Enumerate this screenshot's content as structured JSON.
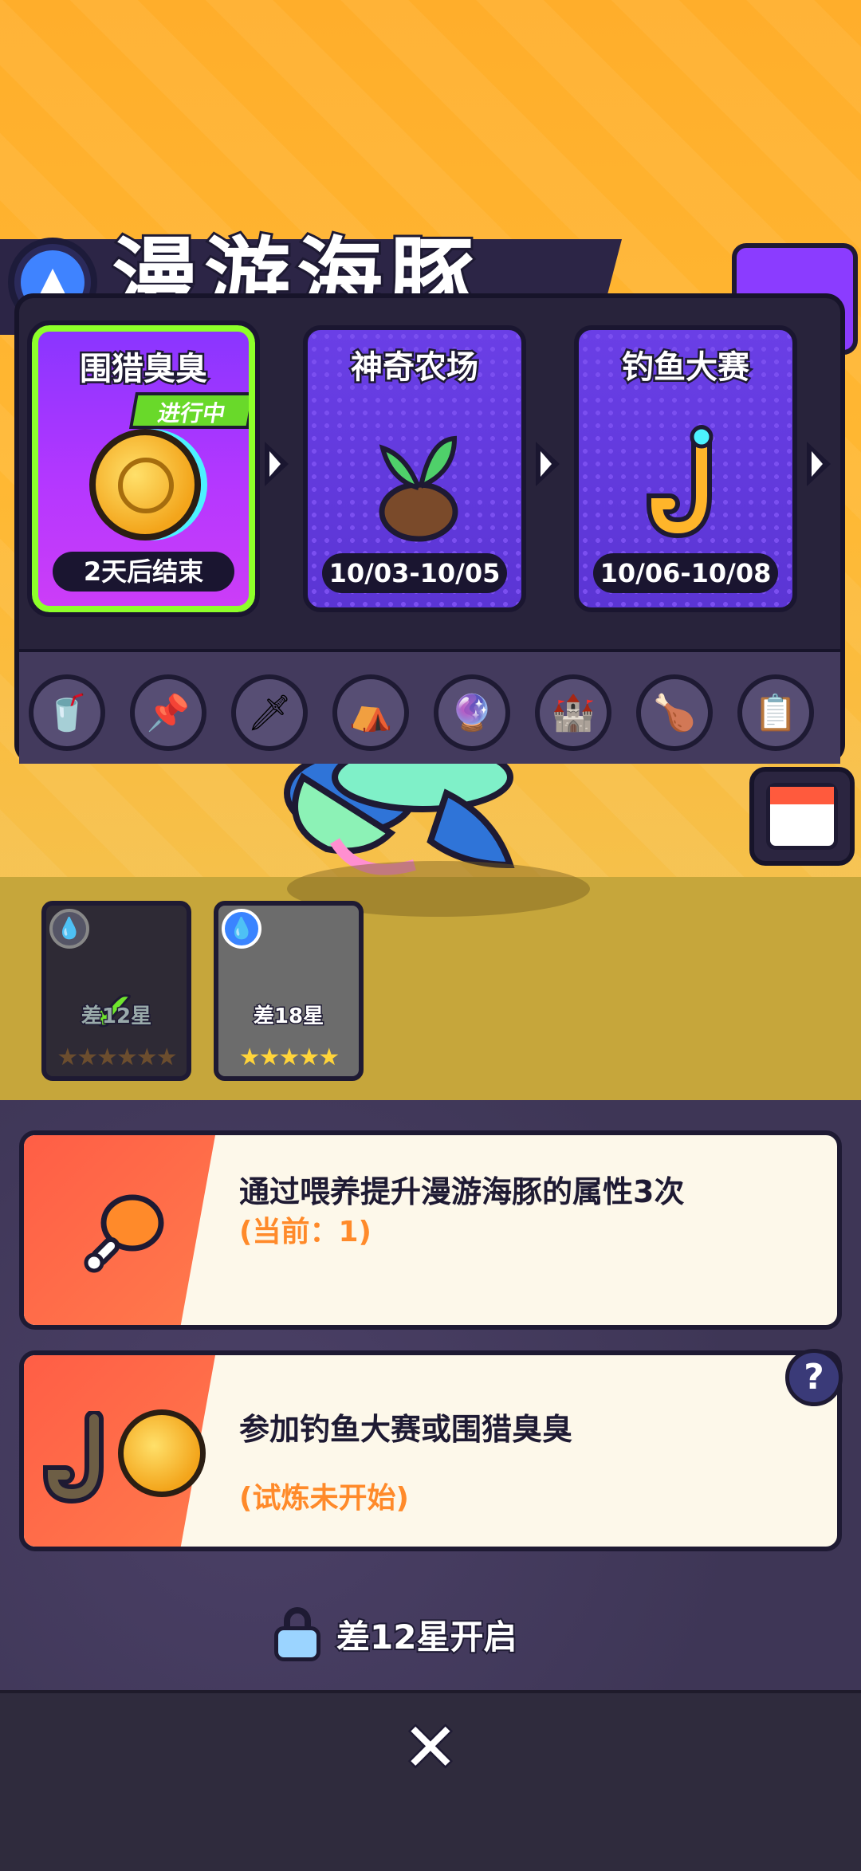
{
  "header": {
    "title": "漫游海豚"
  },
  "events": [
    {
      "title": "围猎臭臭",
      "status_badge": "进行中",
      "date": "2天后结束",
      "icon": "coin-icon",
      "active": true
    },
    {
      "title": "神奇农场",
      "date": "10/03-10/05",
      "icon": "sprout-icon",
      "active": false
    },
    {
      "title": "钓鱼大赛",
      "date": "10/06-10/08",
      "icon": "fishing-hook-icon",
      "active": false
    }
  ],
  "activity_icons": [
    "energy-drink-icon",
    "pin-icon",
    "sword-icon",
    "tent-icon",
    "orb-icon",
    "castle-icon",
    "drumstick-icon",
    "clipboard-check-icon"
  ],
  "pets": [
    {
      "label": "差12星",
      "stars": "★★★★★★",
      "completed": true
    },
    {
      "label": "差18星",
      "stars": "★★★★★",
      "completed": false
    }
  ],
  "tasks": [
    {
      "text": "通过喂养提升漫游海豚的属性3次",
      "sub": "(当前：1)",
      "icon": "drumstick-icon"
    },
    {
      "text": "参加钓鱼大赛或围猎臭臭",
      "sub": "(试炼未开始)",
      "icon": "fishing-hook-icon"
    }
  ],
  "help_label": "?",
  "unlock": {
    "text": "差12星开启"
  },
  "close_label": "✕",
  "colors": {
    "accent_green": "#8dff2a",
    "task_orange": "#ff8a2a",
    "panel": "#28233b"
  }
}
